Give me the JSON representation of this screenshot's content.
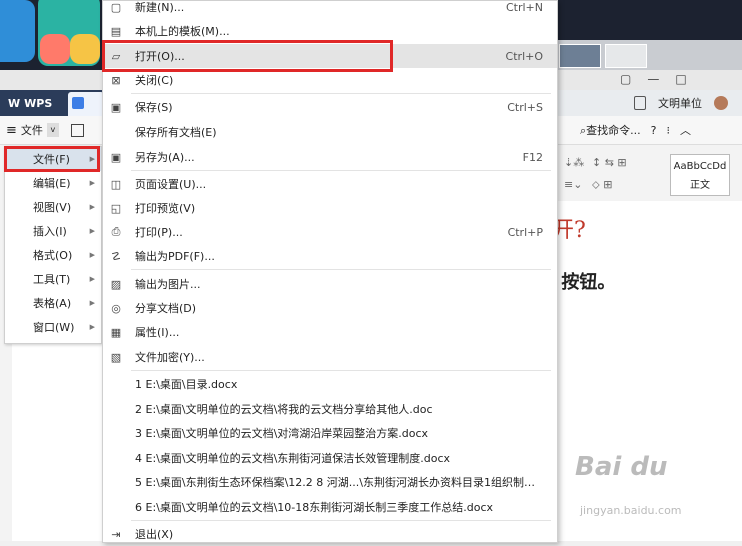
{
  "titlebar": {
    "app_name": "WPS",
    "user_name": "文明单位",
    "tool_a": "▢",
    "tool_b": "—",
    "tool_c": "□"
  },
  "toolbar": {
    "file_label": "文件",
    "find_label": "查找命令...",
    "help_label": "?",
    "style_sample": "AaBbCcDd",
    "style_name": "正文"
  },
  "category_menu": [
    {
      "label": "文件(F)",
      "active": true
    },
    {
      "label": "编辑(E)"
    },
    {
      "label": "视图(V)"
    },
    {
      "label": "插入(I)"
    },
    {
      "label": "格式(O)"
    },
    {
      "label": "工具(T)"
    },
    {
      "label": "表格(A)"
    },
    {
      "label": "窗口(W)"
    }
  ],
  "file_menu": {
    "items": [
      {
        "label": "新建(N)...",
        "shortcut": "Ctrl+N",
        "icon": "new-doc-icon"
      },
      {
        "label": "本机上的模板(M)...",
        "shortcut": "",
        "icon": "template-icon"
      },
      {
        "label": "打开(O)...",
        "shortcut": "Ctrl+O",
        "icon": "folder-open-icon"
      },
      {
        "label": "关闭(C)",
        "shortcut": "",
        "icon": "close-doc-icon"
      },
      {
        "label": "保存(S)",
        "shortcut": "Ctrl+S",
        "icon": "save-icon"
      },
      {
        "label": "保存所有文档(E)",
        "shortcut": "",
        "icon": ""
      },
      {
        "label": "另存为(A)...",
        "shortcut": "F12",
        "icon": "save-as-icon"
      },
      {
        "label": "页面设置(U)...",
        "shortcut": "",
        "icon": "page-setup-icon"
      },
      {
        "label": "打印预览(V)",
        "shortcut": "",
        "icon": "print-preview-icon"
      },
      {
        "label": "打印(P)...",
        "shortcut": "Ctrl+P",
        "icon": "print-icon"
      },
      {
        "label": "输出为PDF(F)...",
        "shortcut": "",
        "icon": "pdf-icon"
      },
      {
        "label": "输出为图片...",
        "shortcut": "",
        "icon": "image-export-icon"
      },
      {
        "label": "分享文档(D)",
        "shortcut": "",
        "icon": "share-icon"
      },
      {
        "label": "属性(I)...",
        "shortcut": "",
        "icon": "properties-icon"
      },
      {
        "label": "文件加密(Y)...",
        "shortcut": "",
        "icon": "encrypt-icon"
      }
    ],
    "recent": [
      "1 E:\\桌面\\目录.docx",
      "2 E:\\桌面\\文明单位的云文档\\将我的云文档分享给其他人.doc",
      "3 E:\\桌面\\文明单位的云文档\\对湾湖沿岸菜园整治方案.docx",
      "4 E:\\桌面\\文明单位的云文档\\东荆街河道保洁长效管理制度.docx",
      "5 E:\\桌面\\东荆街生态环保档案\\12.2 8 河湖...\\东荆街河湖长办资料目录1组织制度.d...",
      "6 E:\\桌面\\文明单位的云文档\\10-18东荆街河湖长制三季度工作总结.docx"
    ],
    "exit_label": "退出(X)"
  },
  "document": {
    "heading_fragment": "开?",
    "text_fragment": "s 按钮。"
  },
  "watermark": {
    "brand": "Bai du",
    "sub": "jingyan.baidu.com"
  },
  "colors": {
    "highlight": "#e02828",
    "tabbar": "#2b3c5a",
    "menu_hover": "#e4e4e4"
  }
}
